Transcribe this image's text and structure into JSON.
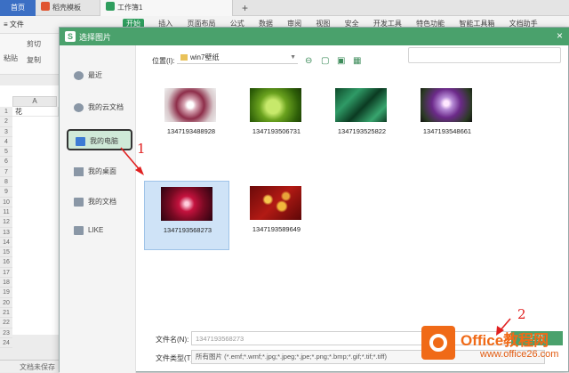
{
  "tabs": {
    "home": "首页",
    "docer": "稻壳模板",
    "workbook": "工作簿1"
  },
  "toolbar": {
    "file_menu": "文件",
    "ribbon_tabs": [
      "开始",
      "插入",
      "页面布局",
      "公式",
      "数据",
      "审阅",
      "视图",
      "安全",
      "开发工具",
      "特色功能",
      "智能工具箱",
      "文档助手"
    ],
    "paste": "粘贴",
    "cut": "剪切",
    "copy": "复制"
  },
  "sheet": {
    "column_header": "A",
    "rows": [
      "1",
      "2",
      "3",
      "4",
      "5",
      "6",
      "7",
      "8",
      "9",
      "10",
      "11",
      "12",
      "13",
      "14",
      "15",
      "16",
      "17",
      "18",
      "19",
      "20",
      "21",
      "22",
      "23",
      "24"
    ],
    "cell_a1": "花"
  },
  "status": {
    "text": "文档未保存"
  },
  "dialog": {
    "title": "选择图片",
    "close": "×",
    "location_label": "位置(I):",
    "location_value": "win7壁纸",
    "search_placeholder": "",
    "sidebar": [
      "最近",
      "我的云文档",
      "我的电脑",
      "我的桌面",
      "我的文档",
      "LIKE"
    ],
    "images": [
      "1347193488928",
      "1347193506731",
      "1347193525822",
      "1347193548661",
      "1347193568273",
      "1347193589649"
    ],
    "filename_label": "文件名(N):",
    "filename_value": "1347193568273",
    "filetype_label": "文件类型(T):",
    "filetype_value": "所有图片 (*.emf;*.wmf;*.jpg;*.jpeg;*.jpe;*.png;*.bmp;*.gif;*.tif;*.tiff)",
    "open_button": "打开"
  },
  "annotations": {
    "step1": "1",
    "step2": "2",
    "arrow_color": "#e02020"
  },
  "watermark": {
    "brand": "Office教程网",
    "url": "www.office26.com",
    "brand_color": "#f06a17"
  },
  "colors": {
    "accent_green": "#4aa16c",
    "selection_blue": "#cfe3f7",
    "active_side": "#cfe9d8"
  }
}
